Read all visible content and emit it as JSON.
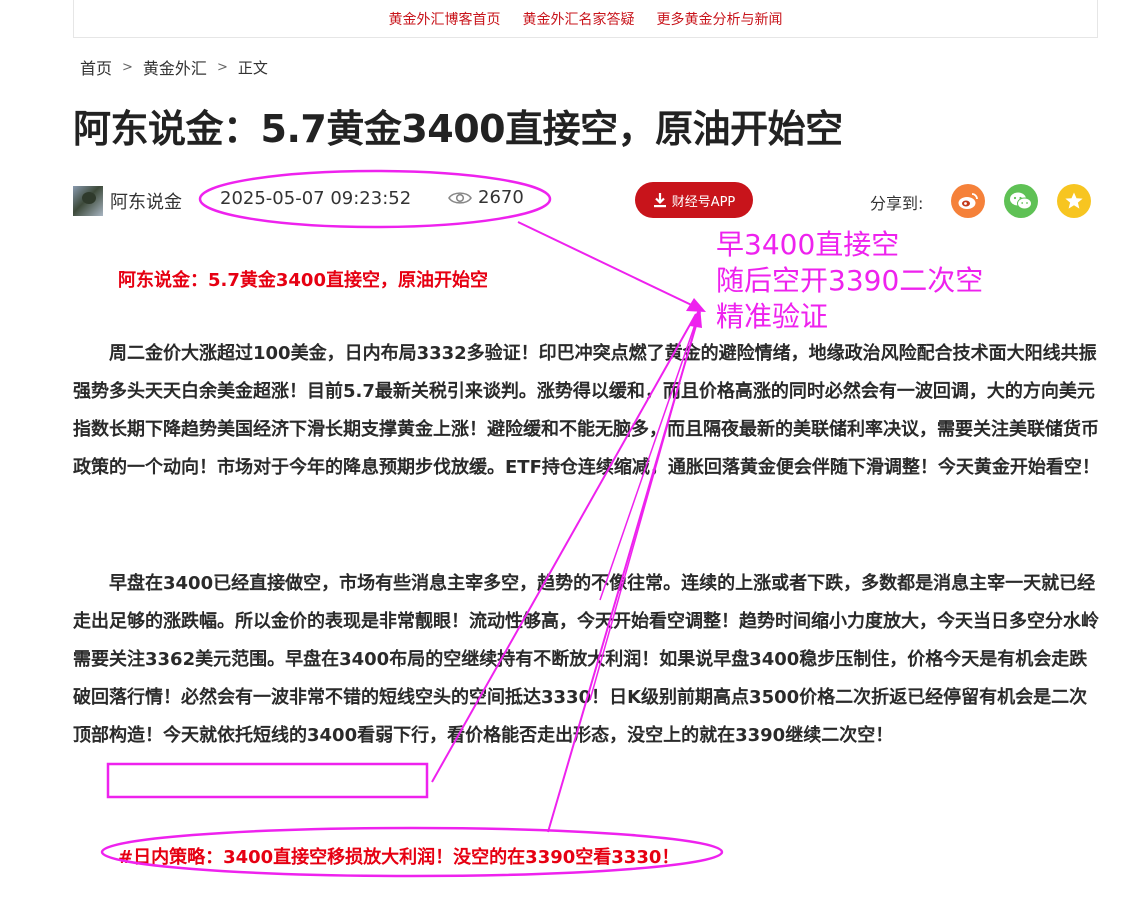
{
  "topnav": {
    "links": [
      "黄金外汇博客首页",
      "黄金外汇名家答疑",
      "更多黄金分析与新闻"
    ]
  },
  "breadcrumb": {
    "home": "首页",
    "separator": ">",
    "category": "黄金外汇",
    "current": "正文"
  },
  "article": {
    "title": "阿东说金：5.7黄金3400直接空，原油开始空",
    "author": "阿东说金",
    "datetime": "2025-05-07 09:23:52",
    "views": "2670",
    "app_button": "财经号APP",
    "share_label": "分享到:",
    "lead": "阿东说金：5.7黄金3400直接空，原油开始空",
    "paragraph1": "周二金价大涨超过100美金，日内布局3332多验证！印巴冲突点燃了黄金的避险情绪，地缘政治风险配合技术面大阳线共振强势多头天天白余美金超涨！目前5.7最新关税引来谈判。涨势得以缓和，而且价格高涨的同时必然会有一波回调，大的方向美元指数长期下降趋势美国经济下滑长期支撑黄金上涨！避险缓和不能无脑多，而且隔夜最新的美联储利率决议，需要关注美联储货币政策的一个动向！市场对于今年的降息预期步伐放缓。ETF持仓连续缩减，通胀回落黄金便会伴随下滑调整！今天黄金开始看空！",
    "paragraph2": "早盘在3400已经直接做空，市场有些消息主宰多空，趋势的不像往常。连续的上涨或者下跌，多数都是消息主宰一天就已经走出足够的涨跌幅。所以金价的表现是非常靓眼！流动性够高，今天开始看空调整！趋势时间缩小力度放大，今天当日多空分水岭需要关注3362美元范围。早盘在3400布局的空继续持有不断放大利润！如果说早盘3400稳步压制住，价格今天是有机会走跌破回落行情！必然会有一波非常不错的短线空头的空间抵达3330！日K级别前期高点3500价格二次折返已经停留有机会是二次顶部构造！今天就依托短线的3400看弱下行，看价格能否走出形态，没空上的就在3390继续二次空！",
    "strategy": "#日内策略：3400直接空移损放大利润！没空的在3390空看3330！"
  },
  "annotation": {
    "lines": [
      "早3400直接空",
      "随后空开3390二次空",
      "精准验证"
    ],
    "color": "#ee22ee"
  },
  "icons": {
    "views": "eye-icon",
    "download": "download-icon",
    "share": [
      "weibo-icon",
      "wechat-icon",
      "qzone-star-icon"
    ]
  },
  "colors": {
    "brand_red": "#c8141b",
    "highlight_red": "#e60012",
    "weibo": "#f5813a",
    "wechat": "#5fc155",
    "qzone": "#f7c521"
  }
}
